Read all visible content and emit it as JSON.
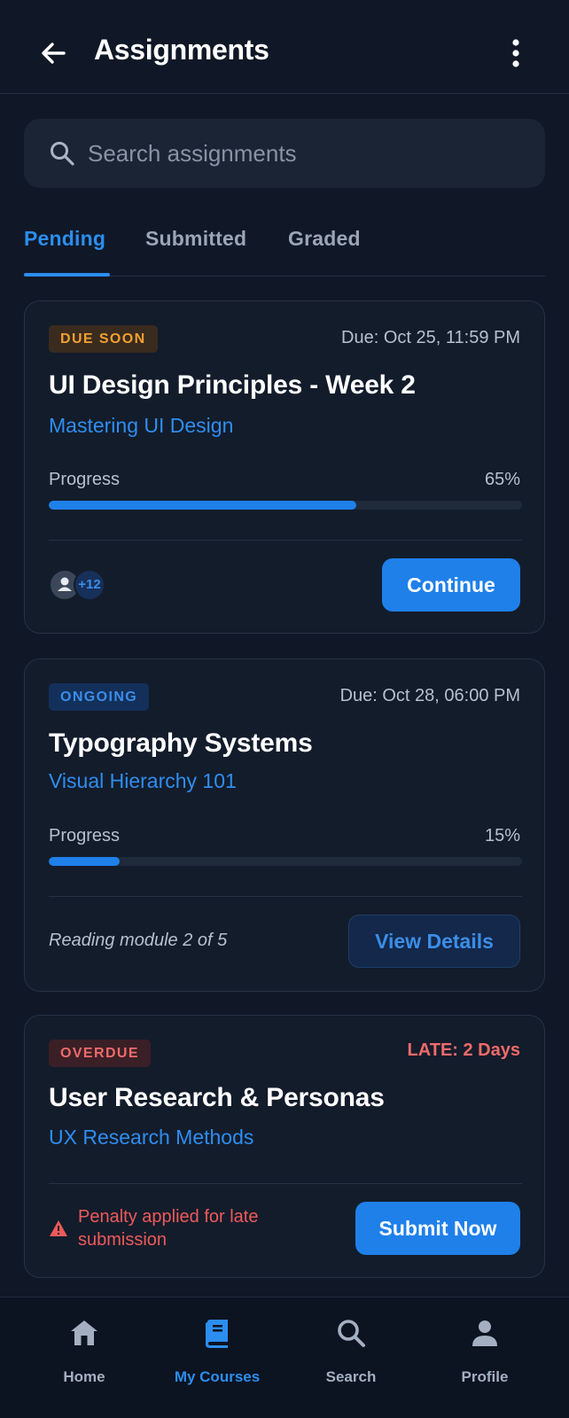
{
  "header": {
    "title": "Assignments"
  },
  "search": {
    "placeholder": "Search assignments",
    "value": ""
  },
  "tabs": [
    {
      "label": "Pending",
      "active": true
    },
    {
      "label": "Submitted",
      "active": false
    },
    {
      "label": "Graded",
      "active": false
    }
  ],
  "assignments": [
    {
      "badge": "DUE SOON",
      "due": "Due: Oct 25, 11:59 PM",
      "title": "UI Design Principles - Week 2",
      "course": "Mastering UI Design",
      "progress_label": "Progress",
      "progress_text": "65%",
      "progress": 0.65,
      "avatar_count": "+12",
      "action": "Continue"
    },
    {
      "badge": "ONGOING",
      "due": "Due: Oct 28, 06:00 PM",
      "title": "Typography Systems",
      "course": "Visual Hierarchy 101",
      "progress_label": "Progress",
      "progress_text": "15%",
      "progress": 0.15,
      "note": "Reading module 2 of 5",
      "action": "View Details"
    },
    {
      "badge": "OVERDUE",
      "late": "LATE: 2 Days",
      "title": "User Research & Personas",
      "course": "UX Research Methods",
      "penalty": "Penalty applied for late submission",
      "action": "Submit Now"
    }
  ],
  "bottom_nav": [
    {
      "label": "Home",
      "icon": "home-icon",
      "active": false
    },
    {
      "label": "My Courses",
      "icon": "book-icon",
      "active": true
    },
    {
      "label": "Search",
      "icon": "search-icon",
      "active": false
    },
    {
      "label": "Profile",
      "icon": "person-icon",
      "active": false
    }
  ],
  "colors": {
    "background": "#101827",
    "card": "#131c2b",
    "accent": "#1f80ea",
    "warning": "#f0a030",
    "danger": "#ee5a5a"
  }
}
